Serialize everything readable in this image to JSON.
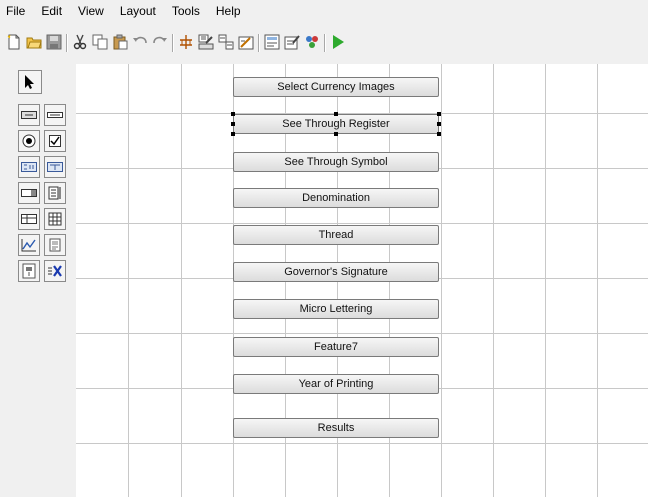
{
  "menu": [
    "File",
    "Edit",
    "View",
    "Layout",
    "Tools",
    "Help"
  ],
  "toolbar_icons": [
    "new-file-icon",
    "open-folder-icon",
    "save-icon",
    "cut-icon",
    "copy-icon",
    "paste-icon",
    "undo-icon",
    "redo-icon",
    "grid-snap-icon",
    "align-icon",
    "size-icon",
    "properties-icon",
    "form-icon",
    "edit-form-icon",
    "debug-icon",
    "run-icon"
  ],
  "palette_icons": [
    "pointer-icon",
    "button-icon",
    "textfield-icon",
    "radio-icon",
    "checkbox-icon",
    "label-icon",
    "text-icon",
    "combobox-icon",
    "list-icon",
    "table-icon",
    "grid-icon",
    "chart-icon",
    "image-icon",
    "slider-icon",
    "formula-icon"
  ],
  "buttons": [
    "Select Currency Images",
    "See Through Register",
    "See Through Symbol",
    "Denomination",
    "Thread",
    "Governor's Signature",
    "Micro Lettering",
    "Feature7",
    "Year of Printing",
    "Results"
  ],
  "selected_button": "See Through Register",
  "colors": {
    "run": "#2eaa2e",
    "chrome": "#f0f0f0",
    "grid": "#c8c8c8"
  }
}
